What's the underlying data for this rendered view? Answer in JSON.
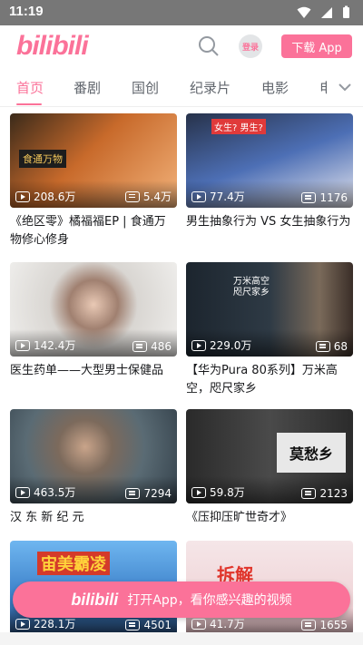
{
  "status_bar": {
    "time": "11:19"
  },
  "header": {
    "logo": "bilibili",
    "login_label": "登录",
    "download_label": "下载 App"
  },
  "tabs": [
    {
      "label": "首页",
      "active": true
    },
    {
      "label": "番剧"
    },
    {
      "label": "国创"
    },
    {
      "label": "纪录片"
    },
    {
      "label": "电影"
    },
    {
      "label": "电"
    }
  ],
  "videos": [
    {
      "title": "《绝区零》橘福福EP | 食通万物修心修身",
      "views": "208.6万",
      "danmaku": "5.4万",
      "thumb_color": "#c86a2b",
      "thumb_overlay": "食通万物"
    },
    {
      "title": "男生抽象行为 VS 女生抽象行为",
      "views": "77.4万",
      "danmaku": "1176",
      "thumb_color": "#4d6fb5",
      "thumb_overlay": "女生? 男生?"
    },
    {
      "title": "医生药单——大型男士保健品",
      "views": "142.4万",
      "danmaku": "486",
      "thumb_color": "#d9d6d2",
      "thumb_overlay": ""
    },
    {
      "title": "【华为Pura 80系列】万米高空，咫尺家乡",
      "views": "229.0万",
      "danmaku": "68",
      "thumb_color": "#2e3a45",
      "thumb_overlay": "万米高空 咫尺家乡"
    },
    {
      "title": "汉 东 新 纪 元",
      "views": "463.5万",
      "danmaku": "7294",
      "thumb_color": "#5a6b74",
      "thumb_overlay": ""
    },
    {
      "title": "《压抑压旷世奇才》",
      "views": "59.8万",
      "danmaku": "2123",
      "thumb_color": "#3f3f3f",
      "thumb_overlay": "莫愁乡"
    },
    {
      "title": "",
      "views": "228.1万",
      "danmaku": "4501",
      "thumb_color": "#3b7fc8",
      "thumb_overlay": "宙美霸凌"
    },
    {
      "title": "",
      "views": "41.7万",
      "danmaku": "1655",
      "thumb_color": "#f0d6d9",
      "thumb_overlay": "拆解"
    }
  ],
  "banner": {
    "logo": "bilibili",
    "text": "打开App，看你感兴趣的视频"
  },
  "colors": {
    "accent": "#fb7299",
    "status_bar": "#777777"
  }
}
